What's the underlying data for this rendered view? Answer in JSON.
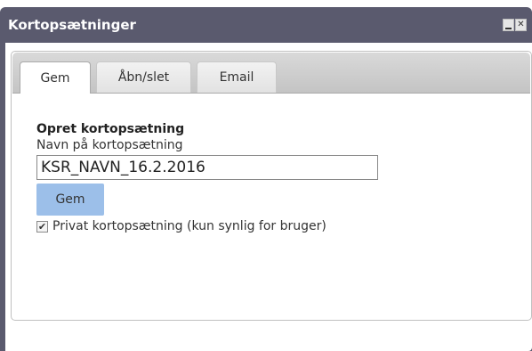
{
  "window": {
    "title": "Kortopsætninger"
  },
  "tabs": [
    {
      "label": "Gem",
      "active": true
    },
    {
      "label": "Åbn/slet",
      "active": false
    },
    {
      "label": "Email",
      "active": false
    }
  ],
  "form": {
    "heading": "Opret kortopsætning",
    "name_label": "Navn på kortopsætning",
    "name_value": "KSR_NAVN_16.2.2016",
    "save_label": "Gem",
    "private_checked": true,
    "private_label": "Privat kortopsætning (kun synlig for bruger)"
  }
}
